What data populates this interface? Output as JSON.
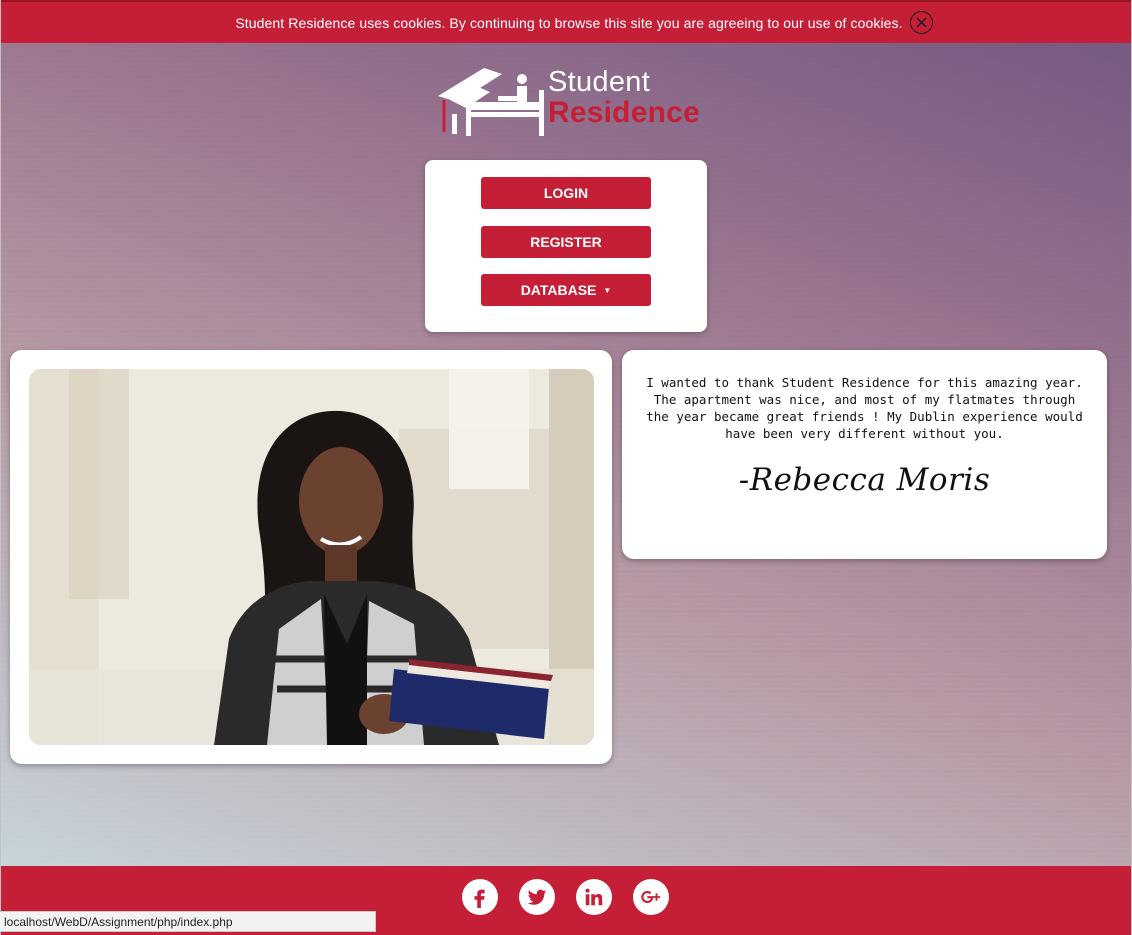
{
  "cookie_bar": {
    "message": "Student Residence uses cookies. By continuing to browse this site you are agreeing to our use of cookies.",
    "close_icon": "close-circle-icon"
  },
  "logo": {
    "word1": "Student",
    "word2": "Residence",
    "icon": "graduation-bed-icon"
  },
  "menu": {
    "login": "LOGIN",
    "register": "REGISTER",
    "database": "DATABASE",
    "database_caret": "▼"
  },
  "testimonial": {
    "quote": "I wanted to thank Student Residence for this amazing year. The apartment was nice, and most of my flatmates through the year became great friends ! My Dublin experience would have been very different without you.",
    "author": "-Rebecca Moris"
  },
  "footer": {
    "social": [
      {
        "name": "facebook-icon"
      },
      {
        "name": "twitter-icon"
      },
      {
        "name": "linkedin-icon"
      },
      {
        "name": "google-plus-icon"
      }
    ]
  },
  "status_bar": {
    "url": "localhost/WebD/Assignment/php/index.php"
  },
  "colors": {
    "brand_red": "#c51f38",
    "white": "#ffffff"
  }
}
